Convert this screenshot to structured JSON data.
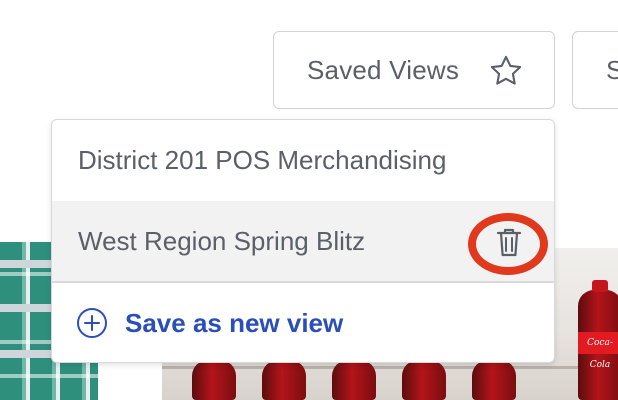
{
  "toolbar": {
    "saved_views_label": "Saved Views",
    "saved_views_icon": "star-icon",
    "next_button_label": "S"
  },
  "dropdown": {
    "items": [
      {
        "label": "District 201 POS Merchandising"
      },
      {
        "label": "West Region Spring Blitz",
        "action_icon": "trash-icon"
      }
    ],
    "save_new": {
      "label": "Save as new view",
      "icon": "plus-circle-icon"
    }
  },
  "background": {
    "bottle_label": "Coca-Cola"
  },
  "colors": {
    "accent_link": "#2b4fb8",
    "highlight_ring": "#e0391d",
    "text": "#5b6068",
    "border": "#d2d4d8"
  }
}
